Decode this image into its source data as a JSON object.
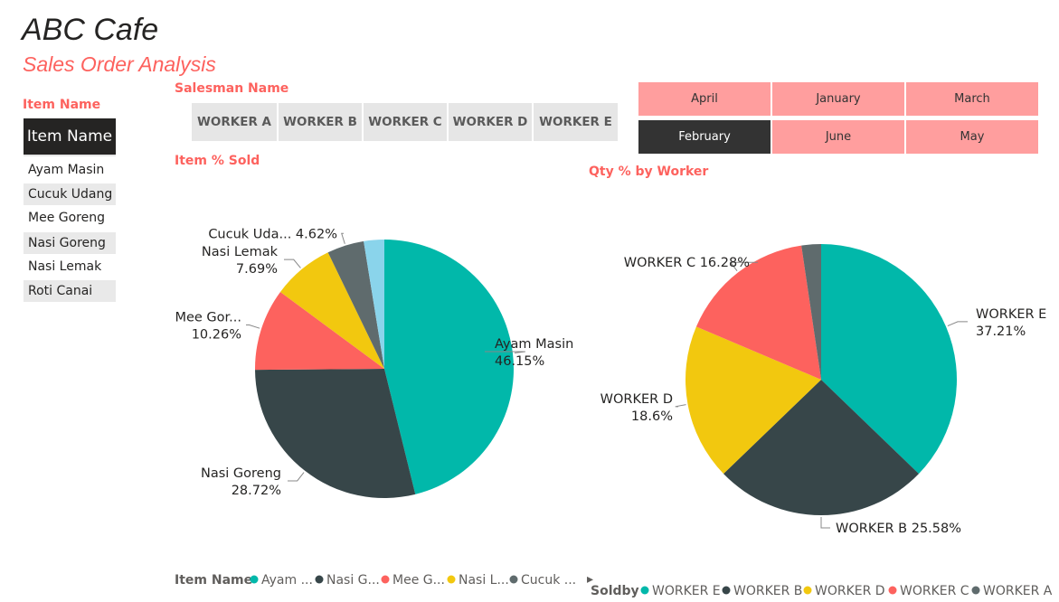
{
  "header": {
    "title": "ABC Cafe",
    "subtitle": "Sales Order Analysis"
  },
  "item_slicer": {
    "label": "Item Name",
    "header": "Item Name",
    "items": [
      "Ayam Masin",
      "Cucuk Udang",
      "Mee Goreng",
      "Nasi Goreng",
      "Nasi Lemak",
      "Roti Canai"
    ]
  },
  "salesman_slicer": {
    "label": "Salesman Name",
    "buttons": [
      "WORKER A",
      "WORKER B",
      "WORKER C",
      "WORKER D",
      "WORKER E"
    ]
  },
  "month_slicer": {
    "tiles": [
      {
        "label": "April",
        "selected": false
      },
      {
        "label": "January",
        "selected": false
      },
      {
        "label": "March",
        "selected": false
      },
      {
        "label": "February",
        "selected": true
      },
      {
        "label": "June",
        "selected": false
      },
      {
        "label": "May",
        "selected": false
      }
    ]
  },
  "colors": {
    "accent": "#fd625e",
    "teal": "#01b8aa",
    "dark": "#374649",
    "red": "#fd625e",
    "yellow": "#f2c80f",
    "gray": "#5f6b6d",
    "lightblue": "#8ad4eb",
    "selected_tile": "#333333",
    "tile": "#ff9e9e"
  },
  "chart_data": [
    {
      "type": "pie",
      "title": "Item % Sold",
      "legend_title": "Item Name",
      "legend_position": "bottom-left",
      "legend_entries": [
        "Ayam ...",
        "Nasi G...",
        "Mee G...",
        "Nasi L...",
        "Cucuk ..."
      ],
      "legend_more": "▸",
      "categories": [
        "Ayam Masin",
        "Nasi Goreng",
        "Mee Goreng",
        "Nasi Lemak",
        "Cucuk Udang",
        "Roti Canai"
      ],
      "values": [
        46.15,
        28.72,
        10.26,
        7.69,
        4.62,
        2.56
      ],
      "colors": [
        "#01b8aa",
        "#374649",
        "#fd625e",
        "#f2c80f",
        "#5f6b6d",
        "#8ad4eb"
      ],
      "labels": [
        {
          "name": "Ayam Masin",
          "value": "46.15%"
        },
        {
          "name": "Nasi Goreng",
          "value": "28.72%"
        },
        {
          "name": "Mee Gor...",
          "value": "10.26%"
        },
        {
          "name": "Nasi Lemak",
          "value": "7.69%"
        },
        {
          "name": "Cucuk Uda...",
          "value": "4.62%"
        }
      ]
    },
    {
      "type": "pie",
      "title": "Qty % by Worker",
      "legend_title": "Soldby",
      "legend_position": "bottom",
      "legend_entries": [
        "WORKER E",
        "WORKER B",
        "WORKER D",
        "WORKER C",
        "WORKER A"
      ],
      "categories": [
        "WORKER E",
        "WORKER B",
        "WORKER D",
        "WORKER C",
        "WORKER A"
      ],
      "values": [
        37.21,
        25.58,
        18.6,
        16.28,
        2.33
      ],
      "colors": [
        "#01b8aa",
        "#374649",
        "#f2c80f",
        "#fd625e",
        "#5f6b6d"
      ],
      "labels": [
        {
          "name": "WORKER E",
          "value": "37.21%"
        },
        {
          "name": "WORKER B",
          "value": "25.58%"
        },
        {
          "name": "WORKER D",
          "value": "18.6%"
        },
        {
          "name": "WORKER C",
          "value": "16.28%"
        }
      ]
    }
  ]
}
